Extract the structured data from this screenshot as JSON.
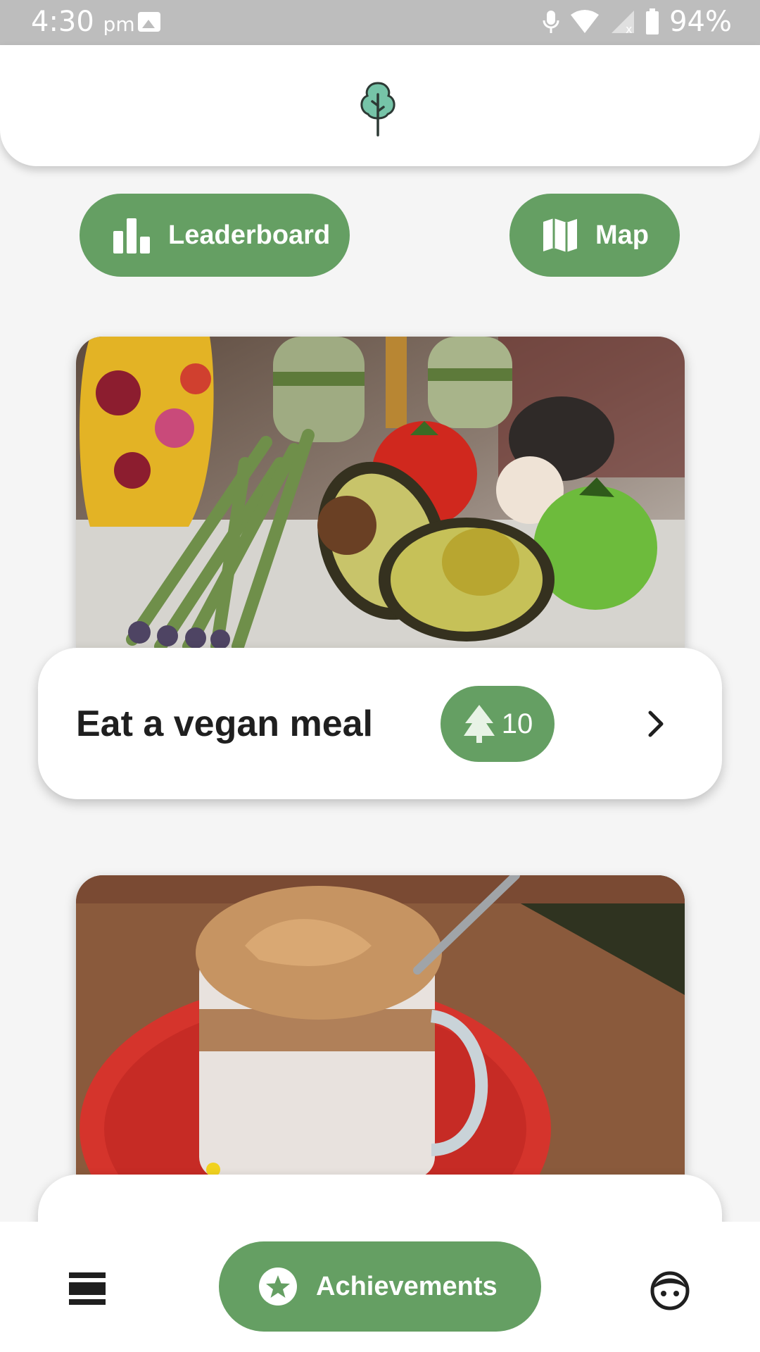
{
  "status_bar": {
    "time": "4:30",
    "time_suffix": "pm",
    "battery": "94%"
  },
  "header": {
    "logo_icon": "tree-icon"
  },
  "top_buttons": {
    "leaderboard_label": "Leaderboard",
    "map_label": "Map"
  },
  "challenges": [
    {
      "title": "Eat a vegan meal",
      "points": "10",
      "image": "vegetables-photo"
    },
    {
      "title": "",
      "points": "",
      "image": "dalgona-coffee-photo"
    }
  ],
  "bottom_nav": {
    "achievements_label": "Achievements"
  },
  "colors": {
    "accent": "#659f63",
    "status_bar": "#bdbdbd",
    "background": "#f5f5f5"
  }
}
